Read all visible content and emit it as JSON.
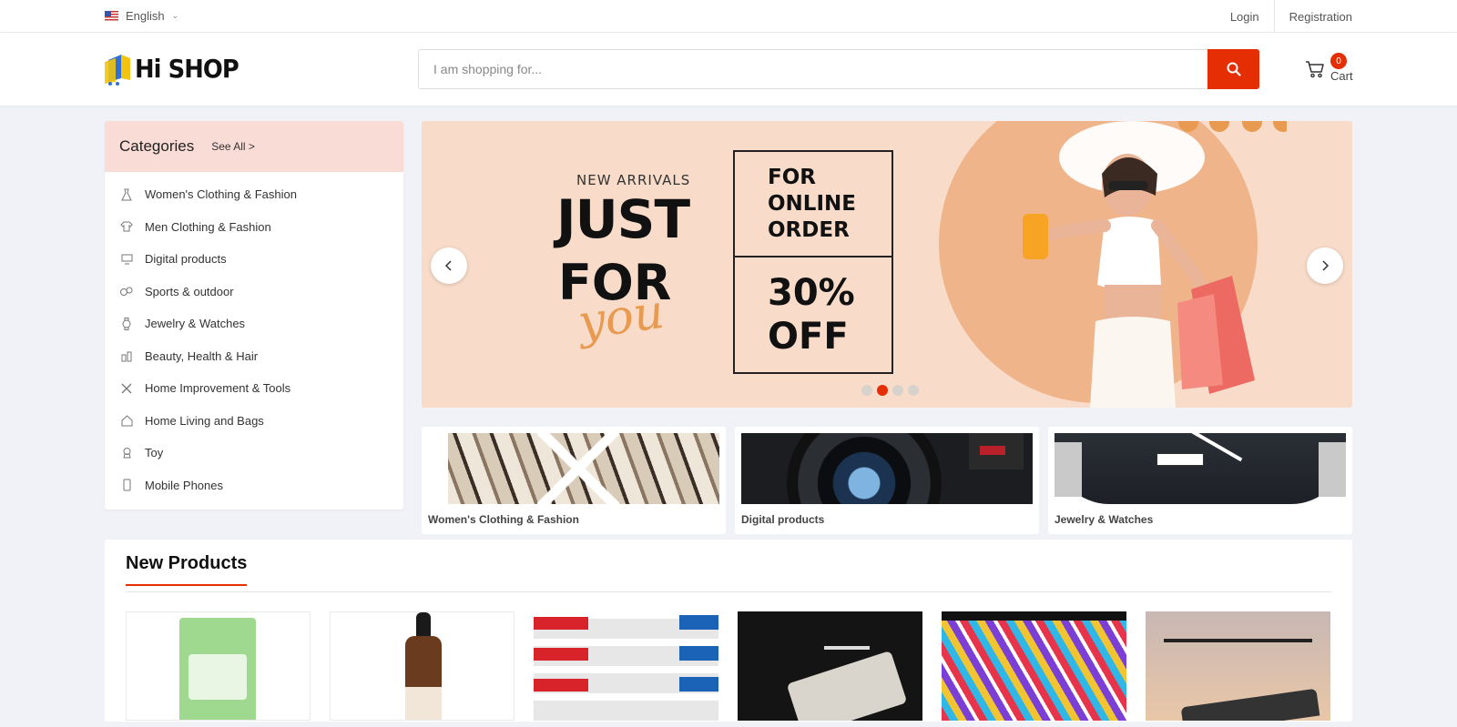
{
  "topbar": {
    "language": "English",
    "login": "Login",
    "registration": "Registration"
  },
  "header": {
    "logo_text": "Hi SHOP",
    "search_placeholder": "I am shopping for...",
    "cart_count": "0",
    "cart_label": "Cart",
    "accent_color": "#e62e04"
  },
  "categories": {
    "title": "Categories",
    "see_all": "See All >",
    "items": [
      {
        "label": "Women's Clothing & Fashion",
        "icon": "dress-icon"
      },
      {
        "label": "Men Clothing & Fashion",
        "icon": "shirt-icon"
      },
      {
        "label": "Digital products",
        "icon": "monitor-icon"
      },
      {
        "label": "Sports & outdoor",
        "icon": "sports-icon"
      },
      {
        "label": "Jewelry & Watches",
        "icon": "watch-icon"
      },
      {
        "label": "Beauty, Health & Hair",
        "icon": "beauty-icon"
      },
      {
        "label": "Home Improvement & Tools",
        "icon": "tools-icon"
      },
      {
        "label": "Home Living and Bags",
        "icon": "home-icon"
      },
      {
        "label": "Toy",
        "icon": "toy-icon"
      },
      {
        "label": "Mobile Phones",
        "icon": "phone-icon"
      }
    ]
  },
  "banner": {
    "new_arrivals": "NEW ARRIVALS",
    "just": "JUST",
    "for": "FOR",
    "you": "you",
    "box1": [
      "FOR",
      "ONLINE",
      "ORDER"
    ],
    "box2": [
      "30%",
      "OFF"
    ],
    "active_slide": 2,
    "slide_count": 4
  },
  "featured_tiles": [
    {
      "label": "Women's Clothing & Fashion"
    },
    {
      "label": "Digital products"
    },
    {
      "label": "Jewelry & Watches"
    }
  ],
  "new_products": {
    "title": "New Products"
  }
}
